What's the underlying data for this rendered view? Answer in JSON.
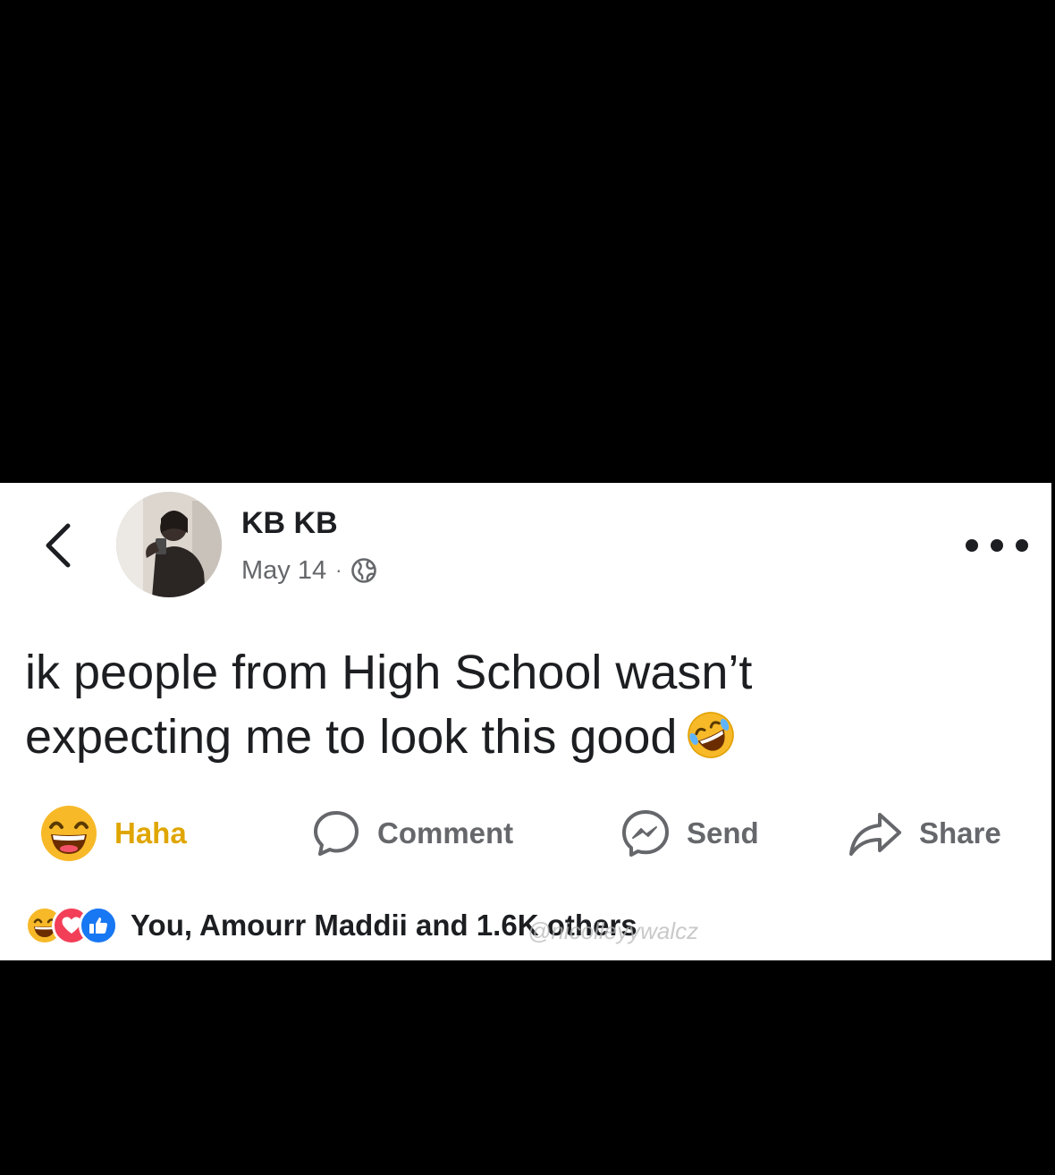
{
  "post": {
    "author_name": "KB KB",
    "date": "May 14",
    "separator": "·",
    "privacy_icon": "globe-icon",
    "text_line1": "ik people from High School wasn’t",
    "text_line2": "expecting me to look this good",
    "text_emoji": "rolling-on-floor-laughing-emoji"
  },
  "actions": {
    "haha_label": "Haha",
    "comment_label": "Comment",
    "send_label": "Send",
    "share_label": "Share"
  },
  "reactions": {
    "summary_text": "You, Amourr Maddii and 1.6K others",
    "types": [
      "haha",
      "love",
      "like"
    ]
  },
  "watermark": {
    "text": "@nicolleyywalcz"
  },
  "colors": {
    "haha_yellow": "#f7b928",
    "love_red": "#f33e58",
    "like_blue": "#1877f2",
    "text_dark": "#1c1e21",
    "text_gray": "#65676b"
  }
}
